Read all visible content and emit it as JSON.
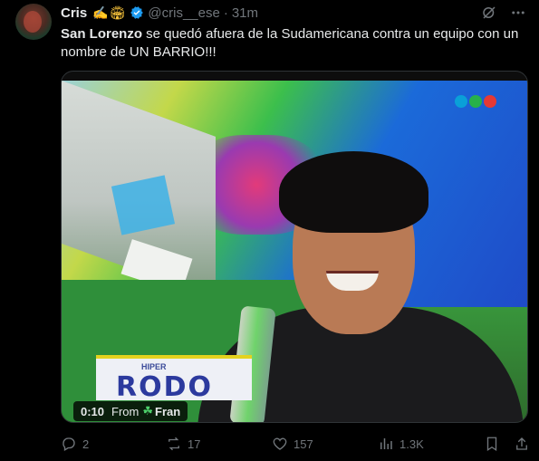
{
  "author": {
    "name": "Cris",
    "emoji": "✍️🏟",
    "handle": "@cris__ese",
    "separator": "·",
    "time": "31m"
  },
  "tweet": {
    "bold_part": "San Lorenzo",
    "text_rest": " se quedó afuera de la Sudamericana contra un equipo con un nombre de UN BARRIO!!!"
  },
  "media": {
    "video_time": "0:10",
    "from_label": "From",
    "source_icon": "clover",
    "source_name": "Fran",
    "overlay_small_text": "HIPER",
    "overlay_big_text": "RODO",
    "network_logo_colors": [
      "#0aa0d8",
      "#27b14a",
      "#e53935"
    ]
  },
  "actions": {
    "replies": "2",
    "reposts": "17",
    "likes": "157",
    "views": "1.3K"
  },
  "colors": {
    "background": "#000000",
    "text": "#e7e9ea",
    "muted": "#71767b",
    "verified": "#1d9bf0"
  }
}
